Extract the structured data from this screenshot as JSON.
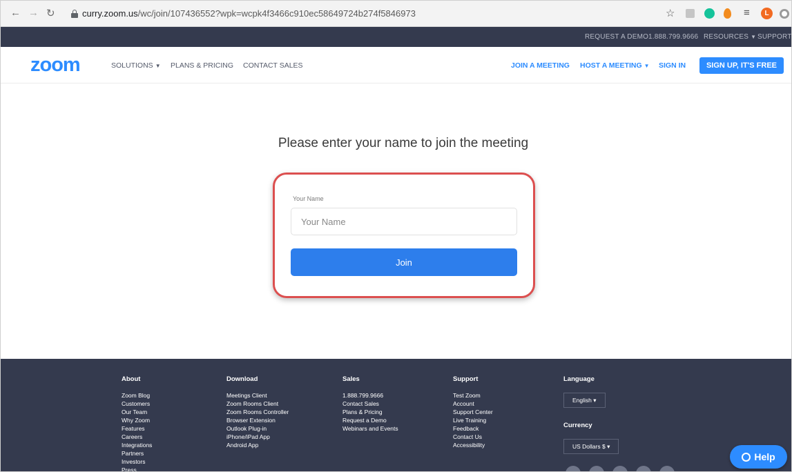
{
  "browser": {
    "url_host": "curry.zoom.us",
    "url_path": "/wc/join/107436552?wpk=wcpk4f3466c910ec58649724b274f5846973",
    "avatar_initial": "L"
  },
  "utility_bar": {
    "request_demo": "REQUEST A DEMO",
    "phone": "1.888.799.9666",
    "resources": "RESOURCES",
    "support": "SUPPORT"
  },
  "header": {
    "logo": "zoom",
    "solutions": "SOLUTIONS",
    "plans": "PLANS & PRICING",
    "contact": "CONTACT SALES",
    "join": "JOIN A MEETING",
    "host": "HOST A MEETING",
    "signin": "SIGN IN",
    "signup": "SIGN UP, IT'S FREE"
  },
  "main": {
    "title": "Please enter your name to join the meeting",
    "name_label": "Your Name",
    "name_placeholder": "Your Name",
    "join_button": "Join"
  },
  "footer": {
    "about": {
      "heading": "About",
      "items": [
        "Zoom Blog",
        "Customers",
        "Our Team",
        "Why Zoom",
        "Features",
        "Careers",
        "Integrations",
        "Partners",
        "Investors",
        "Press"
      ]
    },
    "download": {
      "heading": "Download",
      "items": [
        "Meetings Client",
        "Zoom Rooms Client",
        "Zoom Rooms Controller",
        "Browser Extension",
        "Outlook Plug-in",
        "iPhone/iPad App",
        "Android App"
      ]
    },
    "sales": {
      "heading": "Sales",
      "items": [
        "1.888.799.9666",
        "Contact Sales",
        "Plans & Pricing",
        "Request a Demo",
        "Webinars and Events"
      ]
    },
    "support": {
      "heading": "Support",
      "items": [
        "Test Zoom",
        "Account",
        "Support Center",
        "Live Training",
        "Feedback",
        "Contact Us",
        "Accessibility"
      ]
    },
    "language": {
      "heading": "Language",
      "selected": "English",
      "currency_heading": "Currency",
      "currency_selected": "US Dollars $"
    }
  },
  "help": {
    "label": "Help"
  },
  "colors": {
    "brand_blue": "#2d8cff",
    "dark_bar": "#343a4e",
    "highlight_red": "#dc4f4f"
  }
}
